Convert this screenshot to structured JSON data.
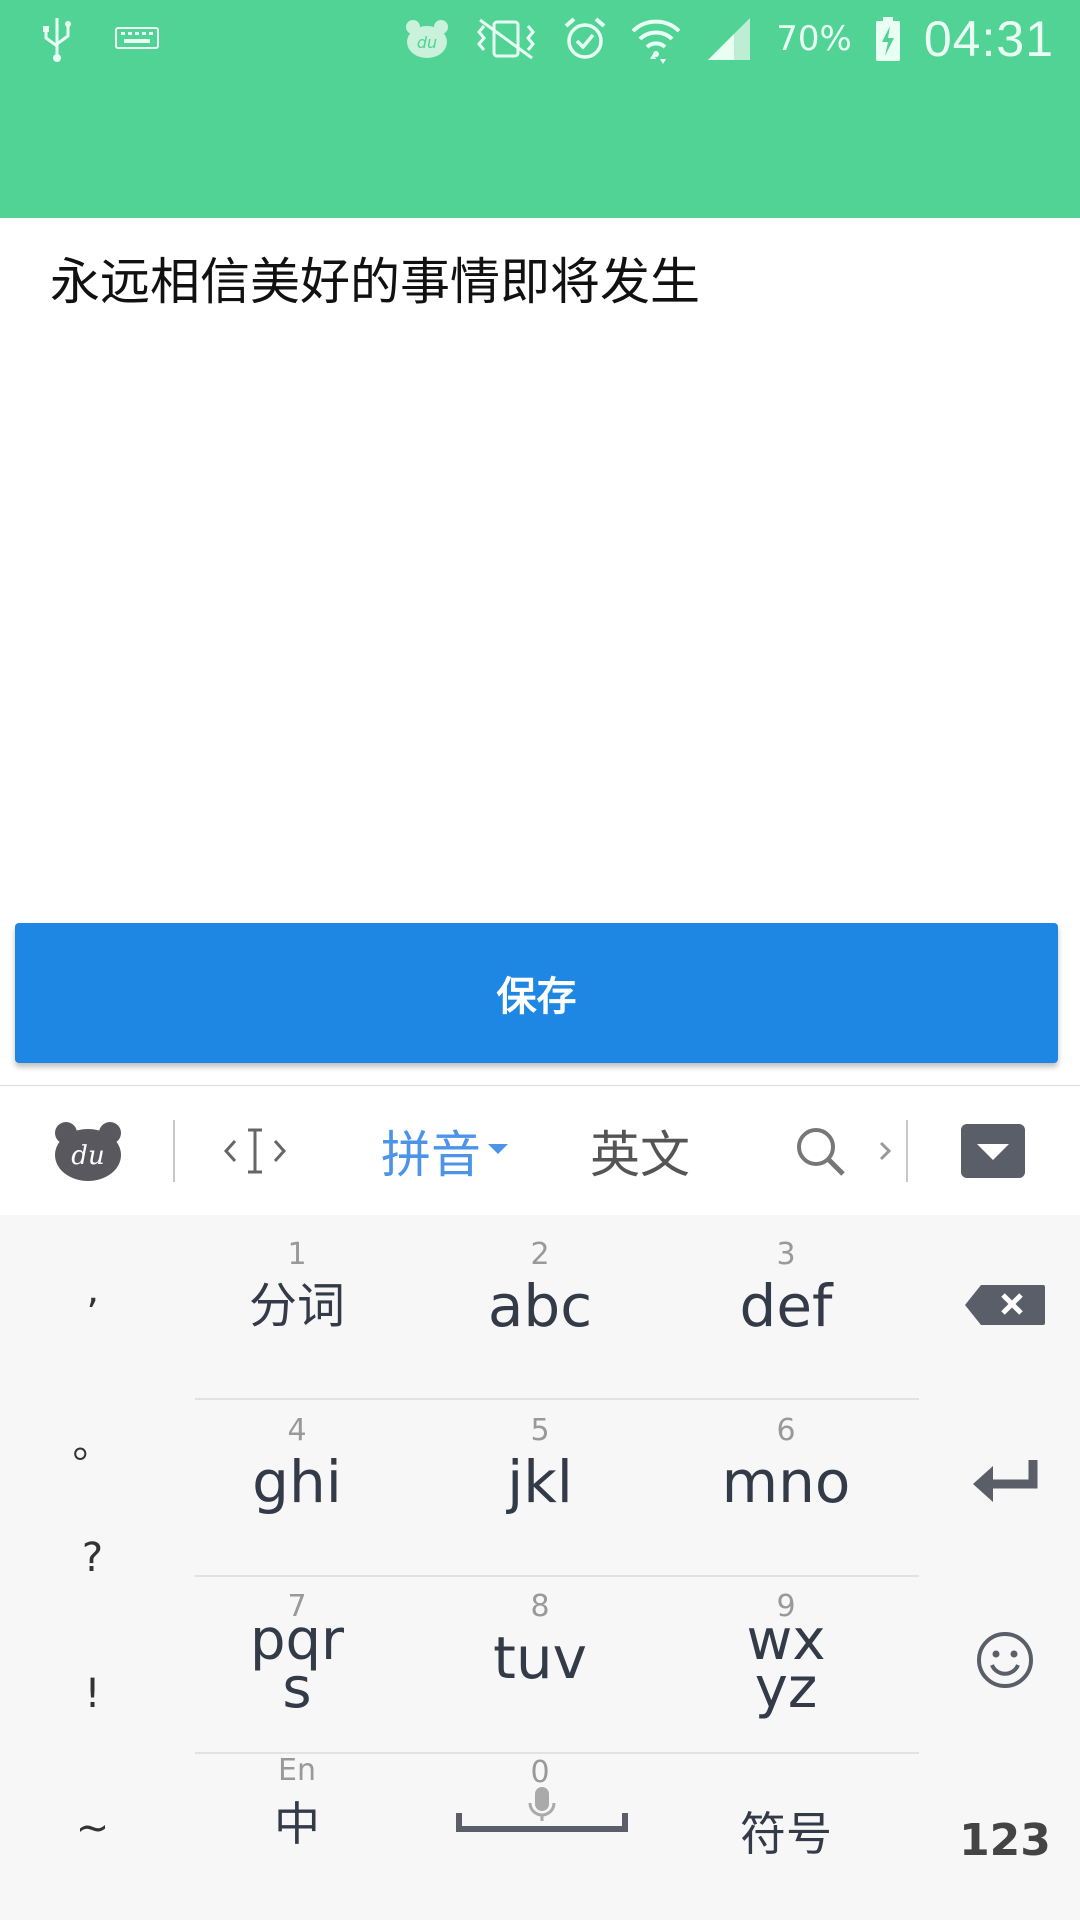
{
  "status_bar": {
    "battery_percent": "70%",
    "time": "04:31"
  },
  "note": {
    "text": "永远相信美好的事情即将发生"
  },
  "save_button": {
    "label": "保存"
  },
  "keyboard_toolbar": {
    "pinyin_label": "拼音",
    "english_label": "英文"
  },
  "keyboard": {
    "symbols": [
      "’",
      "。",
      "?",
      "!",
      "~"
    ],
    "keys": [
      {
        "num": "1",
        "label": "分词"
      },
      {
        "num": "2",
        "label": "abc"
      },
      {
        "num": "3",
        "label": "def"
      },
      {
        "num": "4",
        "label": "ghi"
      },
      {
        "num": "5",
        "label": "jkl"
      },
      {
        "num": "6",
        "label": "mno"
      },
      {
        "num": "7",
        "label": "pqrs"
      },
      {
        "num": "8",
        "label": "tuv"
      },
      {
        "num": "9",
        "label": "wxyz"
      }
    ],
    "bottom": {
      "en_label": "En",
      "zh_label": "中",
      "zero": "0",
      "symbols_label": "符号",
      "num_label": "123"
    }
  },
  "colors": {
    "header": "#50d395",
    "save_button": "#1e86e3",
    "pinyin_active": "#4c94e8"
  }
}
